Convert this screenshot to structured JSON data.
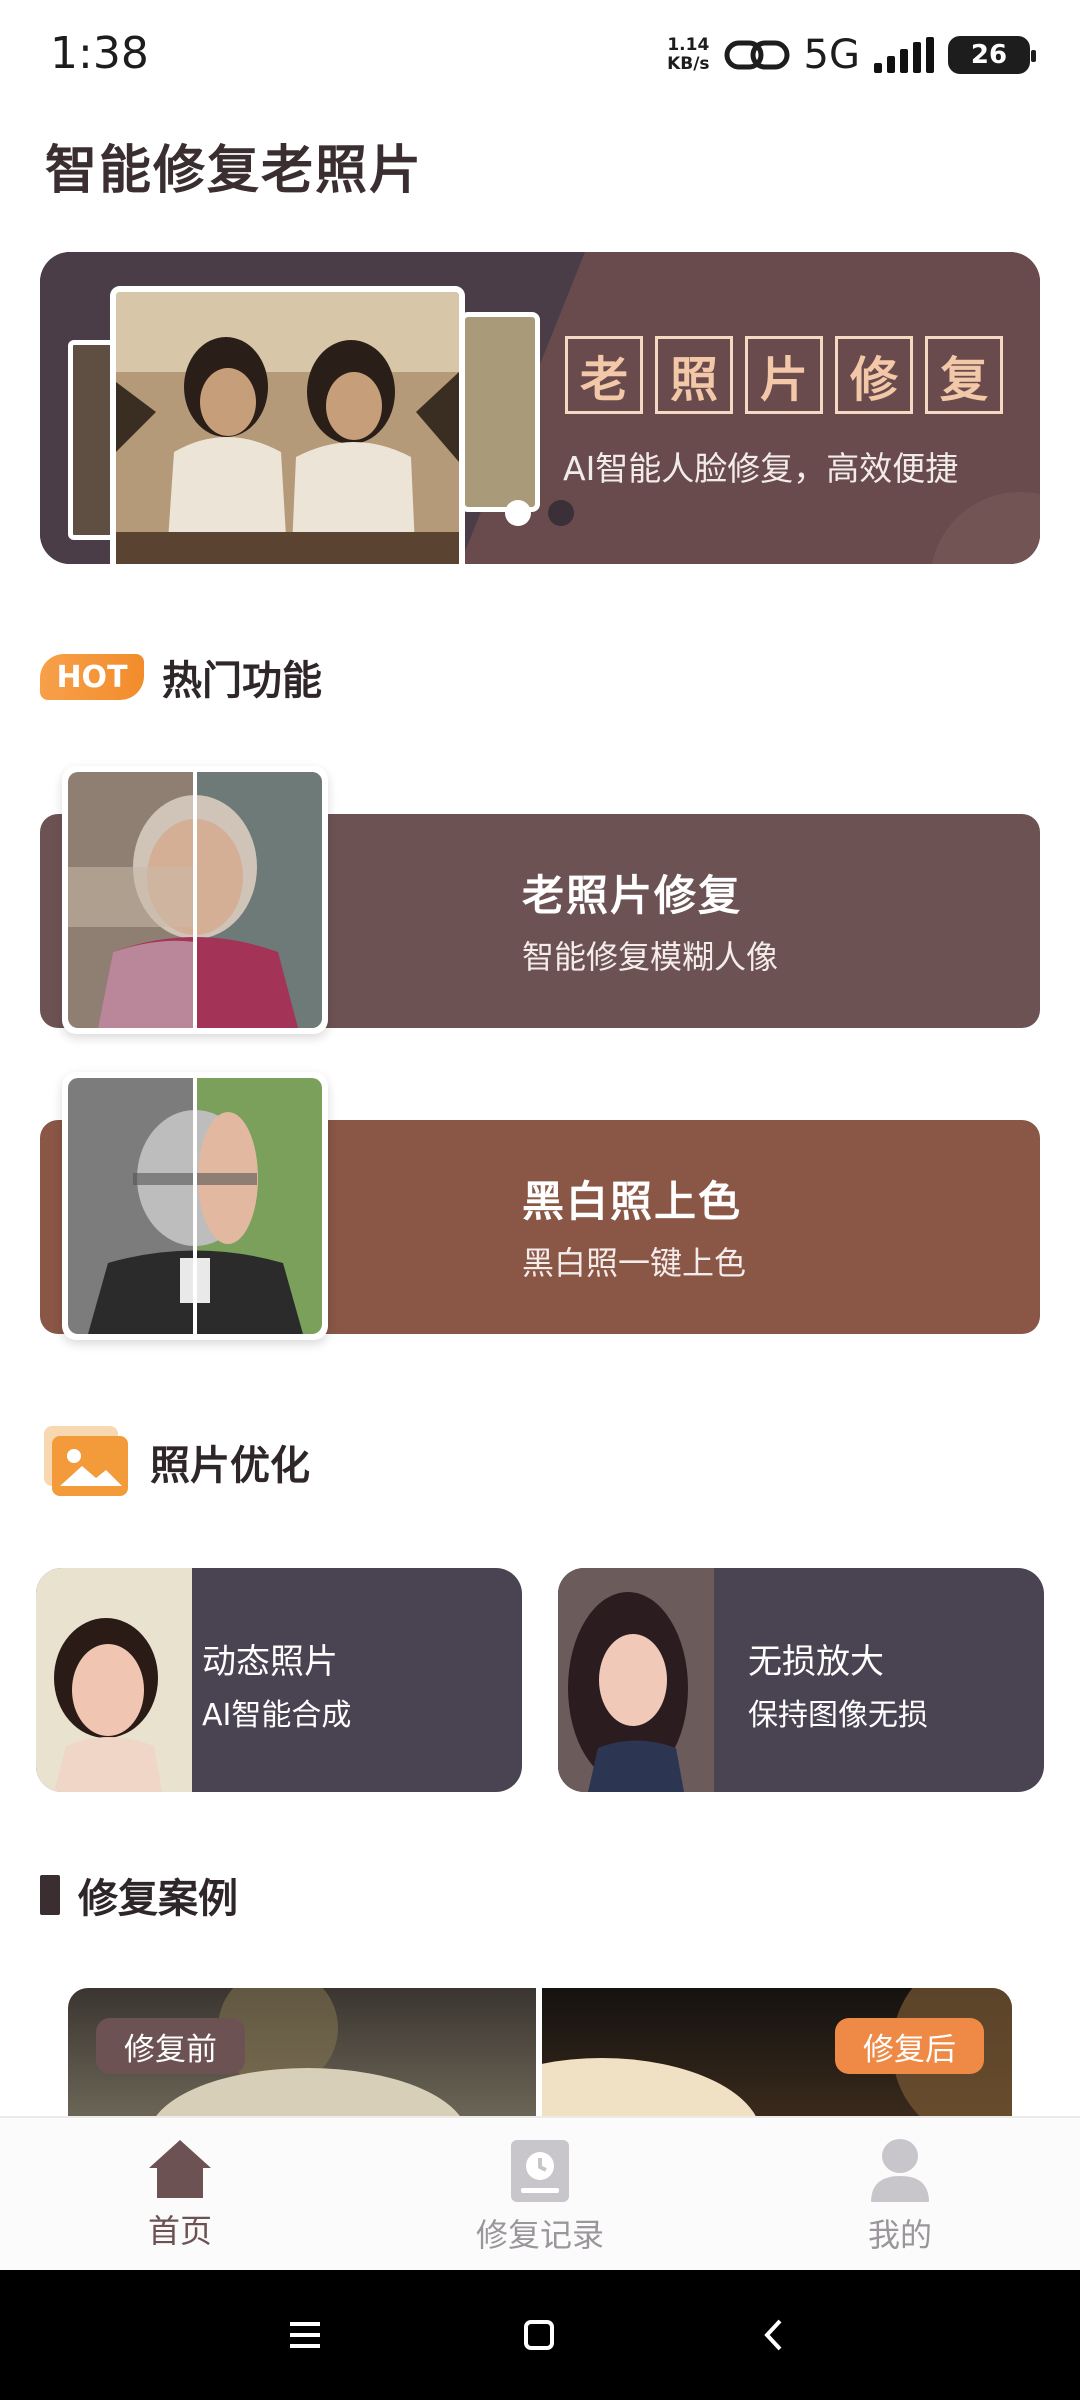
{
  "status_bar": {
    "time": "1:38",
    "net_speed_value": "1.14",
    "net_speed_unit": "KB/s",
    "network": "5G",
    "battery": "26"
  },
  "page_title": "智能修复老照片",
  "banner": {
    "title_chars": [
      "老",
      "照",
      "片",
      "修",
      "复"
    ],
    "subtitle": "AI智能人脸修复，高效便捷",
    "active_dot": 1,
    "dot_count": 2
  },
  "hot_section": {
    "badge": "HOT",
    "title": "热门功能",
    "cards": [
      {
        "title": "老照片修复",
        "subtitle": "智能修复模糊人像",
        "color": "#6d5253"
      },
      {
        "title": "黑白照上色",
        "subtitle": "黑白照一键上色",
        "color": "#8a5646"
      }
    ]
  },
  "optimize_section": {
    "title": "照片优化",
    "cards": [
      {
        "title": "动态照片",
        "subtitle": "AI智能合成"
      },
      {
        "title": "无损放大",
        "subtitle": "保持图像无损"
      }
    ]
  },
  "case_section": {
    "title": "修复案例",
    "before_label": "修复前",
    "after_label": "修复后"
  },
  "bottom_nav": {
    "items": [
      {
        "label": "首页",
        "icon": "home-icon",
        "active": true
      },
      {
        "label": "修复记录",
        "icon": "history-icon",
        "active": false
      },
      {
        "label": "我的",
        "icon": "profile-icon",
        "active": false
      }
    ]
  },
  "colors": {
    "brand_dark": "#6d5253",
    "accent_orange": "#f28c2b",
    "banner_bg": "#4a3d47",
    "card_dark": "#4a4452"
  }
}
